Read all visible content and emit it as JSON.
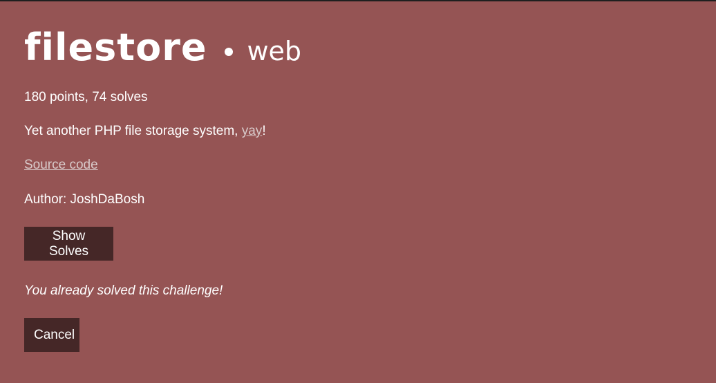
{
  "challenge": {
    "name": "filestore",
    "category": "web",
    "points_solves": "180 points, 74 solves",
    "description_prefix": "Yet another PHP file storage system, ",
    "description_link": "yay",
    "description_suffix": "!",
    "source_link": "Source code",
    "author": "Author: JoshDaBosh",
    "solved_message": "You already solved this challenge!"
  },
  "buttons": {
    "show_solves": "Show Solves",
    "cancel": "Cancel"
  },
  "colors": {
    "modal_background": "#955454",
    "button_background": "#452727",
    "link": "#d9cbcb"
  }
}
